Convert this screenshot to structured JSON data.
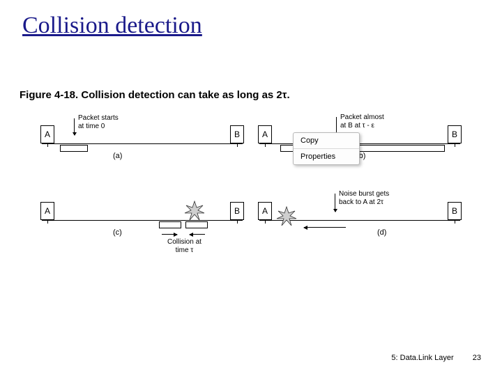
{
  "title": "Collision detection",
  "figure_caption": "Figure 4-18. Collision detection can take as long as 2τ.",
  "nodes": {
    "A": "A",
    "B": "B"
  },
  "panels": {
    "a": {
      "label": "(a)",
      "annotation": "Packet starts\nat time 0"
    },
    "b": {
      "label": "(b)",
      "annotation": "Packet almost\nat B at τ - ε"
    },
    "c": {
      "label": "(c)",
      "annotation": "Collision at\ntime τ"
    },
    "d": {
      "label": "(d)",
      "annotation": "Noise burst gets\nback to A at 2τ"
    }
  },
  "context_menu": {
    "items": [
      "Copy",
      "Properties"
    ]
  },
  "footer": {
    "chapter": "5: Data.Link Layer",
    "page": "23"
  }
}
